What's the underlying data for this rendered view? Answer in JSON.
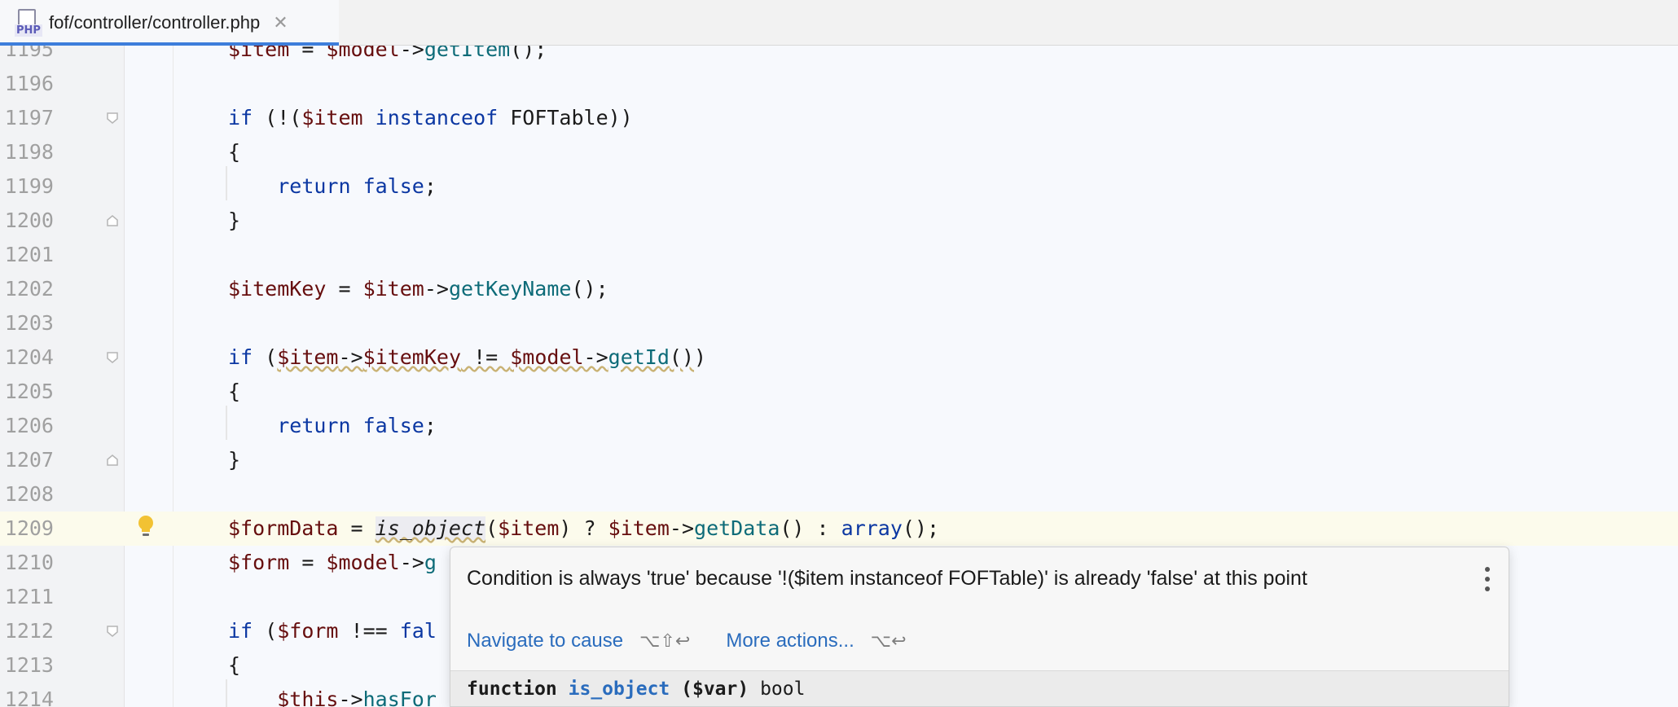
{
  "tab": {
    "icon_label": "PHP",
    "title": "fof/controller/controller.php",
    "close": "✕"
  },
  "colors": {
    "keyword": "#0b37a2",
    "variable": "#660e0e",
    "function": "#0d6b78",
    "link": "#2a6cbd",
    "accent": "#3d7edb"
  },
  "lines": [
    {
      "n": "1195",
      "code": "$item = $model->getItem();"
    },
    {
      "n": "1196",
      "code": ""
    },
    {
      "n": "1197",
      "code": "if (!($item instanceof FOFTable))"
    },
    {
      "n": "1198",
      "code": "{"
    },
    {
      "n": "1199",
      "code": "    return false;"
    },
    {
      "n": "1200",
      "code": "}"
    },
    {
      "n": "1201",
      "code": ""
    },
    {
      "n": "1202",
      "code": "$itemKey = $item->getKeyName();"
    },
    {
      "n": "1203",
      "code": ""
    },
    {
      "n": "1204",
      "code": "if ($item->$itemKey != $model->getId())"
    },
    {
      "n": "1205",
      "code": "{"
    },
    {
      "n": "1206",
      "code": "    return false;"
    },
    {
      "n": "1207",
      "code": "}"
    },
    {
      "n": "1208",
      "code": ""
    },
    {
      "n": "1209",
      "code": "$formData = is_object($item) ? $item->getData() : array();"
    },
    {
      "n": "1210",
      "code": "$form = $model->g"
    },
    {
      "n": "1211",
      "code": ""
    },
    {
      "n": "1212",
      "code": "if ($form !== fal"
    },
    {
      "n": "1213",
      "code": "{"
    },
    {
      "n": "1214",
      "code": "    $this->hasFor"
    }
  ],
  "popup": {
    "message": "Condition is always 'true' because '!($item instanceof FOFTable)' is already 'false' at this point",
    "navigate_label": "Navigate to cause",
    "navigate_shortcut": "⌥⇧↩",
    "more_label": "More actions...",
    "more_shortcut": "⌥↩",
    "doc_keyword": "function",
    "doc_name": "is_object",
    "doc_params": "($var)",
    "doc_return": "bool"
  }
}
